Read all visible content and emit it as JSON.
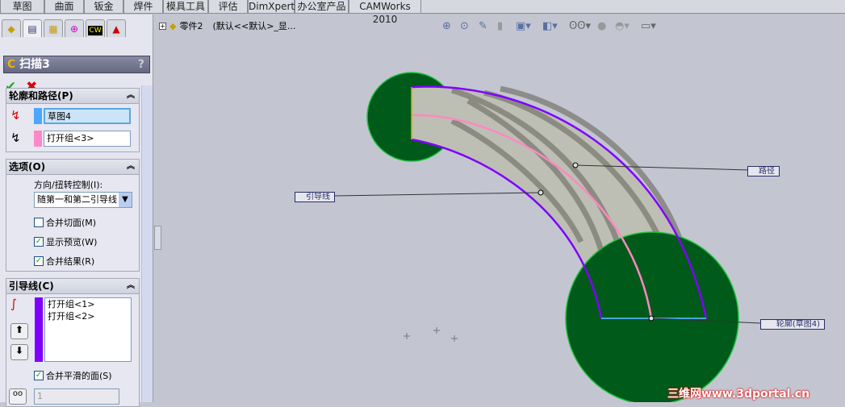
{
  "command_tabs": [
    "草图",
    "曲面",
    "钣金",
    "焊件",
    "模具工具",
    "评估",
    "DimXpert",
    "办公室产品",
    "CAMWorks 2010"
  ],
  "panel_tabs": [
    "feature-manager",
    "property-manager",
    "configuration-manager",
    "dimxpert-manager",
    "camworks",
    "display-manager"
  ],
  "feature": {
    "title": "扫描3",
    "help": "?",
    "ok": "✔",
    "cancel": "✖"
  },
  "profile_path": {
    "header": "轮廓和路径(P)",
    "profile_value": "草图4",
    "path_value": "打开组<3>",
    "profile_color": "#4da6ff",
    "path_color": "#ff88c8"
  },
  "options": {
    "header": "选项(O)",
    "twist_label": "方向/扭转控制(I):",
    "twist_value": "随第一和第二引导线",
    "merge_tangent": {
      "label": "合并切面(M)",
      "checked": false
    },
    "show_preview": {
      "label": "显示预览(W)",
      "checked": true
    },
    "merge_result": {
      "label": "合并结果(R)",
      "checked": true
    }
  },
  "guides": {
    "header": "引导线(C)",
    "items": [
      "打开组<1>",
      "打开组<2>"
    ],
    "color": "#8000ff",
    "merge_smooth": {
      "label": "合并平滑的面(S)",
      "checked": true
    },
    "count": "1"
  },
  "tree": {
    "part": "零件2",
    "config": "(默认<<默认>_显..."
  },
  "callouts": {
    "path": "路径",
    "guide": "引导线",
    "profile": "轮廓(草图4)"
  },
  "watermark": "三维网www.3dportal.cn"
}
